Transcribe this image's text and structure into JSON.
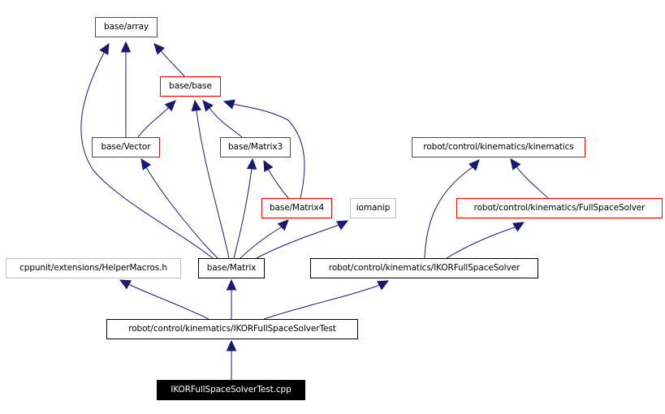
{
  "diagram": {
    "type": "include-dependency-graph",
    "edge_color": "#191970",
    "nodes": [
      {
        "id": "array",
        "label": "base/array",
        "style": "red"
      },
      {
        "id": "base",
        "label": "base/base",
        "style": "red"
      },
      {
        "id": "vector",
        "label": "base/Vector",
        "style": "red"
      },
      {
        "id": "matrix3",
        "label": "base/Matrix3",
        "style": "red"
      },
      {
        "id": "kinematics",
        "label": "robot/control/kinematics/kinematics",
        "style": "red"
      },
      {
        "id": "matrix4",
        "label": "base/Matrix4",
        "style": "red"
      },
      {
        "id": "iomanip",
        "label": "iomanip",
        "style": "gray"
      },
      {
        "id": "fullspace",
        "label": "robot/control/kinematics/FullSpaceSolver",
        "style": "red"
      },
      {
        "id": "helpermacros",
        "label": "cppunit/extensions/HelperMacros.h",
        "style": "gray"
      },
      {
        "id": "matrix",
        "label": "base/Matrix",
        "style": "black"
      },
      {
        "id": "ikor",
        "label": "robot/control/kinematics/IKORFullSpaceSolver",
        "style": "black"
      },
      {
        "id": "ikortest",
        "label": "robot/control/kinematics/IKORFullSpaceSolverTest",
        "style": "black"
      },
      {
        "id": "cpp",
        "label": "IKORFullSpaceSolverTest.cpp",
        "style": "root"
      }
    ],
    "edges": [
      {
        "from": "base",
        "to": "array"
      },
      {
        "from": "vector",
        "to": "array"
      },
      {
        "from": "vector",
        "to": "base"
      },
      {
        "from": "matrix3",
        "to": "base"
      },
      {
        "from": "matrix4",
        "to": "matrix3"
      },
      {
        "from": "matrix4",
        "to": "base"
      },
      {
        "from": "matrix",
        "to": "array"
      },
      {
        "from": "matrix",
        "to": "base"
      },
      {
        "from": "matrix",
        "to": "vector"
      },
      {
        "from": "matrix",
        "to": "matrix3"
      },
      {
        "from": "matrix",
        "to": "matrix4"
      },
      {
        "from": "matrix",
        "to": "iomanip"
      },
      {
        "from": "fullspace",
        "to": "kinematics"
      },
      {
        "from": "ikor",
        "to": "kinematics"
      },
      {
        "from": "ikor",
        "to": "fullspace"
      },
      {
        "from": "ikortest",
        "to": "helpermacros"
      },
      {
        "from": "ikortest",
        "to": "matrix"
      },
      {
        "from": "ikortest",
        "to": "ikor"
      },
      {
        "from": "cpp",
        "to": "ikortest"
      }
    ]
  }
}
